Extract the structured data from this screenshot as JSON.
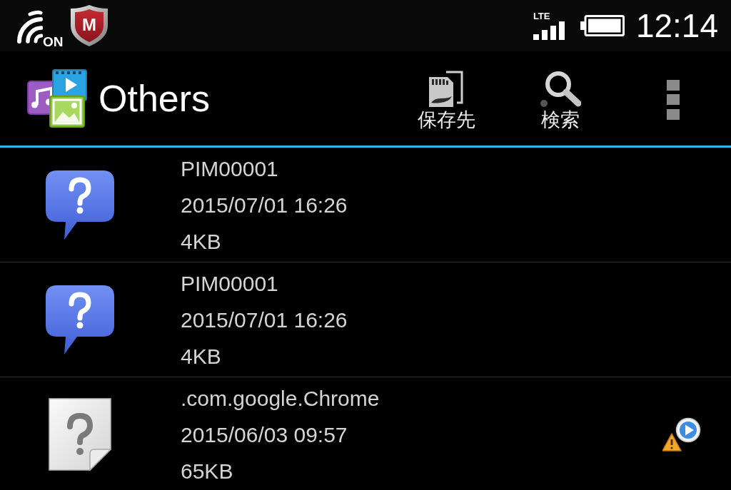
{
  "status_bar": {
    "nfc_label": "ON",
    "security_badge_letter": "M",
    "network_type": "LTE",
    "time": "12:14"
  },
  "action_bar": {
    "title": "Others",
    "actions": [
      {
        "kind": "storage",
        "label": "保存先"
      },
      {
        "kind": "search",
        "label": "検索"
      }
    ]
  },
  "files": [
    {
      "kind": "unknown",
      "name": "PIM00001",
      "modified": "2015/07/01 16:26",
      "size": "4KB",
      "warning": false
    },
    {
      "kind": "unknown",
      "name": "PIM00001",
      "modified": "2015/07/01 16:26",
      "size": "4KB",
      "warning": false
    },
    {
      "kind": "document",
      "name": ".com.google.Chrome",
      "modified": "2015/06/03 09:57",
      "size": "65KB",
      "warning": true
    }
  ]
}
